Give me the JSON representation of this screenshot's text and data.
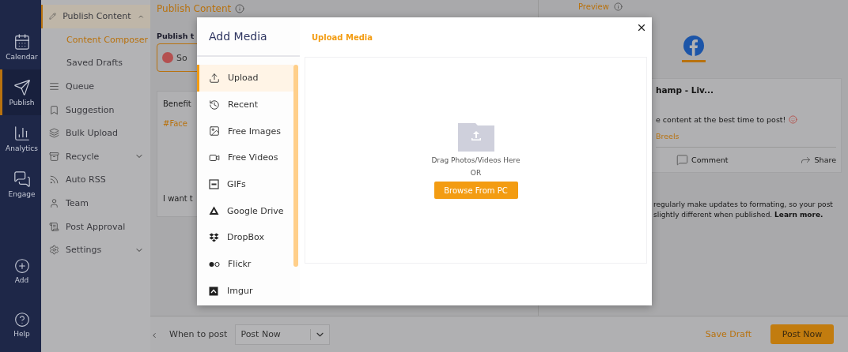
{
  "rail": {
    "items": [
      {
        "label": "Calendar",
        "selected": false
      },
      {
        "label": "Publish",
        "selected": true
      },
      {
        "label": "Analytics",
        "selected": false
      },
      {
        "label": "Engage",
        "selected": false
      }
    ],
    "bottom": [
      {
        "label": "Add"
      },
      {
        "label": "Help"
      }
    ]
  },
  "sidebar": {
    "items": [
      {
        "label": "Publish Content",
        "expanded": true,
        "children": [
          {
            "label": "Content Composer",
            "selected": true
          },
          {
            "label": "Saved Drafts",
            "selected": false
          }
        ]
      },
      {
        "label": "Queue"
      },
      {
        "label": "Suggestion"
      },
      {
        "label": "Bulk Upload"
      },
      {
        "label": "Recycle",
        "expanded": false
      },
      {
        "label": "Auto RSS"
      },
      {
        "label": "Team"
      },
      {
        "label": "Post Approval"
      },
      {
        "label": "Settings",
        "expanded": false
      }
    ]
  },
  "composer": {
    "title": "Publish Content",
    "publish_to_label": "Publish t",
    "account": "So",
    "post_title": "Benefit",
    "hashtag": "#Face",
    "prompt": "I want t"
  },
  "preview": {
    "title": "Preview",
    "account_name": "hamp - Liv...",
    "text": "e content at the best time to post!",
    "tags": "Breels",
    "actions": [
      "Comment",
      "Share"
    ],
    "note_lines": [
      "regularly make updates to formating, so your post",
      "slightly different when published. **Learn more.**"
    ]
  },
  "bottom_bar": {
    "when_label": "When to post",
    "when_value": "Post Now",
    "save_draft": "Save Draft",
    "post_now": "Post Now"
  },
  "modal": {
    "title": "Add Media",
    "sources": [
      {
        "label": "Upload",
        "selected": true
      },
      {
        "label": "Recent",
        "selected": false
      },
      {
        "label": "Free Images",
        "selected": false
      },
      {
        "label": "Free Videos",
        "selected": false
      },
      {
        "label": "GIFs",
        "selected": false
      },
      {
        "label": "Google Drive",
        "selected": false
      },
      {
        "label": "DropBox",
        "selected": false
      },
      {
        "label": "Flickr",
        "selected": false
      },
      {
        "label": "Imgur",
        "selected": false
      }
    ],
    "panel_title": "Upload Media",
    "drop_text": "Drag Photos/Videos Here",
    "or_text": "OR",
    "browse_button": "Browse From PC"
  }
}
